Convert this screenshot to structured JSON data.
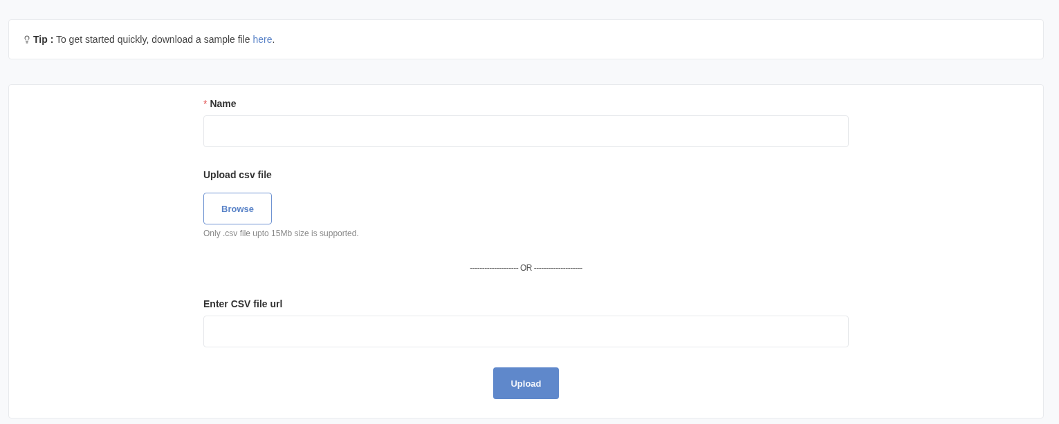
{
  "tip": {
    "label": "Tip :",
    "text": "To get started quickly, download a sample file",
    "link": "here",
    "end": "."
  },
  "form": {
    "name_field": {
      "required_mark": "*",
      "label": "Name"
    },
    "upload": {
      "label": "Upload csv file",
      "button": "Browse",
      "hint": "Only .csv file upto 15Mb size is supported."
    },
    "separator": "-------------------- OR --------------------",
    "url_field": {
      "label": "Enter CSV file url"
    },
    "submit": "Upload"
  }
}
